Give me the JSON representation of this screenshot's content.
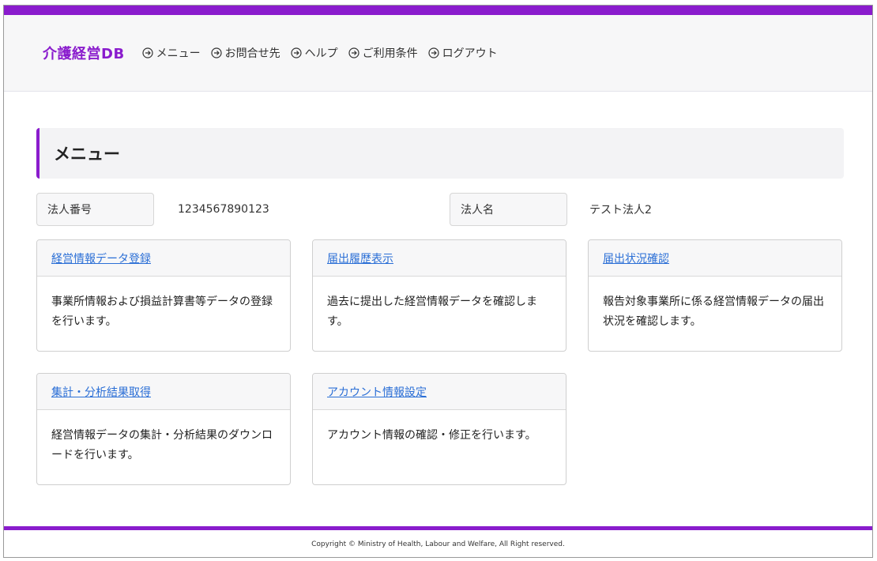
{
  "header": {
    "brand": "介護経営DB",
    "nav": [
      {
        "label": "メニュー"
      },
      {
        "label": "お問合せ先"
      },
      {
        "label": "ヘルプ"
      },
      {
        "label": "ご利用条件"
      },
      {
        "label": "ログアウト"
      }
    ]
  },
  "page": {
    "title": "メニュー"
  },
  "info": {
    "corp_number_label": "法人番号",
    "corp_number_value": "1234567890123",
    "corp_name_label": "法人名",
    "corp_name_value": "テスト法人2"
  },
  "cards": [
    {
      "title": "経営情報データ登録",
      "description": "事業所情報および損益計算書等データの登録を行います。"
    },
    {
      "title": "届出履歴表示",
      "description": "過去に提出した経営情報データを確認します。"
    },
    {
      "title": "届出状況確認",
      "description": "報告対象事業所に係る経営情報データの届出状況を確認します。"
    },
    {
      "title": "集計・分析結果取得",
      "description": "経営情報データの集計・分析結果のダウンロードを行います。"
    },
    {
      "title": "アカウント情報設定",
      "description": "アカウント情報の確認・修正を行います。"
    }
  ],
  "footer": {
    "copyright": "Copyright © Ministry of Health, Labour and Welfare, All Right reserved."
  },
  "colors": {
    "accent": "#8a1ccd",
    "link": "#2b6fd6"
  },
  "icons": {
    "nav_icon": "circle-arrow-right-icon"
  }
}
